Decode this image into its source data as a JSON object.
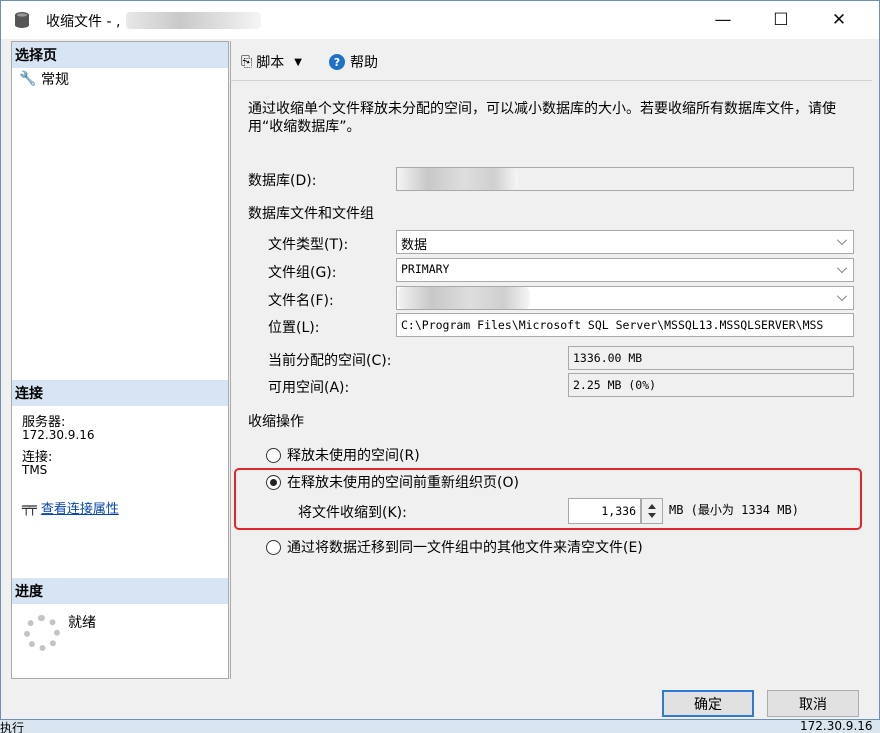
{
  "window": {
    "title": "收缩文件 - ,",
    "min_glyph": "—",
    "max_glyph": "☐",
    "close_glyph": "✕"
  },
  "left": {
    "pages_header": "选择页",
    "pages": [
      {
        "label": "常规",
        "icon": "wrench-icon"
      }
    ],
    "connection_header": "连接",
    "server_label": "服务器:",
    "server_value": "172.30.9.16",
    "connection_label": "连接:",
    "connection_value": "TMS",
    "view_props_link": "查看连接属性",
    "progress_header": "进度",
    "progress_status": "就绪"
  },
  "toolbar": {
    "script_label": "脚本",
    "help_label": "帮助"
  },
  "main": {
    "description": "通过收缩单个文件释放未分配的空间，可以减小数据库的大小。若要收缩所有数据库文件，请使用“收缩数据库”。",
    "database_label": "数据库(D):",
    "files_group_label": "数据库文件和文件组",
    "file_type_label": "文件类型(T):",
    "file_type_value": "数据",
    "filegroup_label": "文件组(G):",
    "filegroup_value": "PRIMARY",
    "filename_label": "文件名(F):",
    "location_label": "位置(L):",
    "location_value": "C:\\Program Files\\Microsoft SQL Server\\MSSQL13.MSSQLSERVER\\MSS",
    "allocated_label": "当前分配的空间(C):",
    "allocated_value": "1336.00 MB",
    "free_label": "可用空间(A):",
    "free_value": "2.25 MB (0%)",
    "shrink_action_label": "收缩操作",
    "opt_release": "释放未使用的空间(R)",
    "opt_reorganize": "在释放未使用的空间前重新组织页(O)",
    "shrink_to_label": "将文件收缩到(K):",
    "shrink_to_value": "1,336",
    "shrink_hint": "MB (最小为 1334 MB)",
    "opt_empty": "通过将数据迁移到同一文件组中的其他文件来清空文件(E)",
    "selected_option": "reorganize"
  },
  "buttons": {
    "ok": "确定",
    "cancel": "取消"
  },
  "background": {
    "status_left": "执行",
    "status_right": "172.30.9.16"
  },
  "colors": {
    "section_header": "#d6e4f3",
    "highlight_border": "#e0282c",
    "link": "#0645ad",
    "ok_border": "#2d7bd4"
  }
}
